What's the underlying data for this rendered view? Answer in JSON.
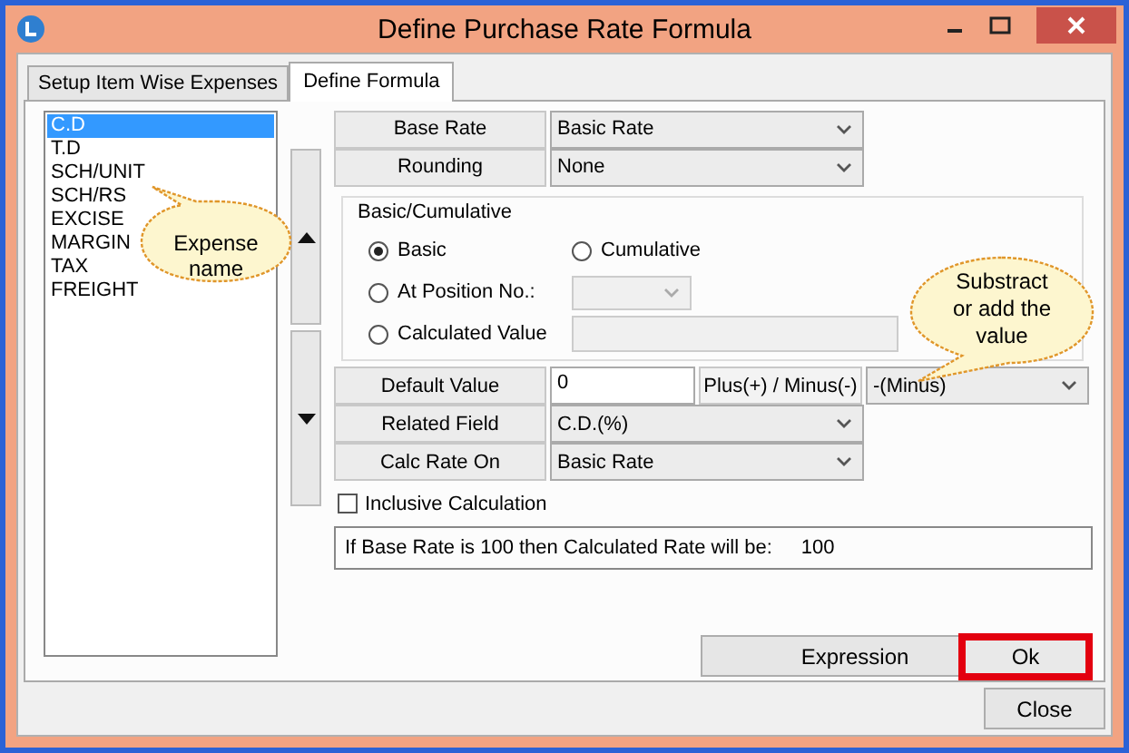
{
  "window": {
    "title": "Define Purchase Rate Formula"
  },
  "tabs": [
    {
      "label": "Setup Item Wise Expenses",
      "selected": false
    },
    {
      "label": "Define Formula",
      "selected": true
    }
  ],
  "expenses": [
    {
      "label": "C.D",
      "selected": true
    },
    {
      "label": "T.D",
      "selected": false
    },
    {
      "label": "SCH/UNIT",
      "selected": false
    },
    {
      "label": "SCH/RS",
      "selected": false
    },
    {
      "label": "EXCISE",
      "selected": false
    },
    {
      "label": "MARGIN",
      "selected": false
    },
    {
      "label": "TAX",
      "selected": false
    },
    {
      "label": "FREIGHT",
      "selected": false
    }
  ],
  "base_rate": {
    "label": "Base Rate",
    "value": "Basic Rate"
  },
  "rounding": {
    "label": "Rounding",
    "value": "None"
  },
  "basic_cumulative": {
    "title": "Basic/Cumulative",
    "options": [
      {
        "label": "Basic",
        "selected": true
      },
      {
        "label": "Cumulative",
        "selected": false
      },
      {
        "label": "At Position No.:",
        "selected": false
      },
      {
        "label": "Calculated Value",
        "selected": false
      }
    ]
  },
  "default_value": {
    "label": "Default Value",
    "value": "0",
    "sign_label": "Plus(+) / Minus(-)",
    "sign_value": "-(Minus)"
  },
  "related_field": {
    "label": "Related Field",
    "value": "C.D.(%)"
  },
  "calc_rate_on": {
    "label": "Calc Rate On",
    "value": "Basic Rate"
  },
  "inclusive_calculation": {
    "label": "Inclusive Calculation",
    "checked": false
  },
  "result": {
    "text": "If Base Rate is 100 then Calculated Rate will be:",
    "value": "100"
  },
  "buttons": {
    "expression": "Expression",
    "ok": "Ok",
    "close": "Close"
  },
  "callouts": [
    {
      "text": "Expense name"
    },
    {
      "text": "Substract or add the value"
    }
  ]
}
